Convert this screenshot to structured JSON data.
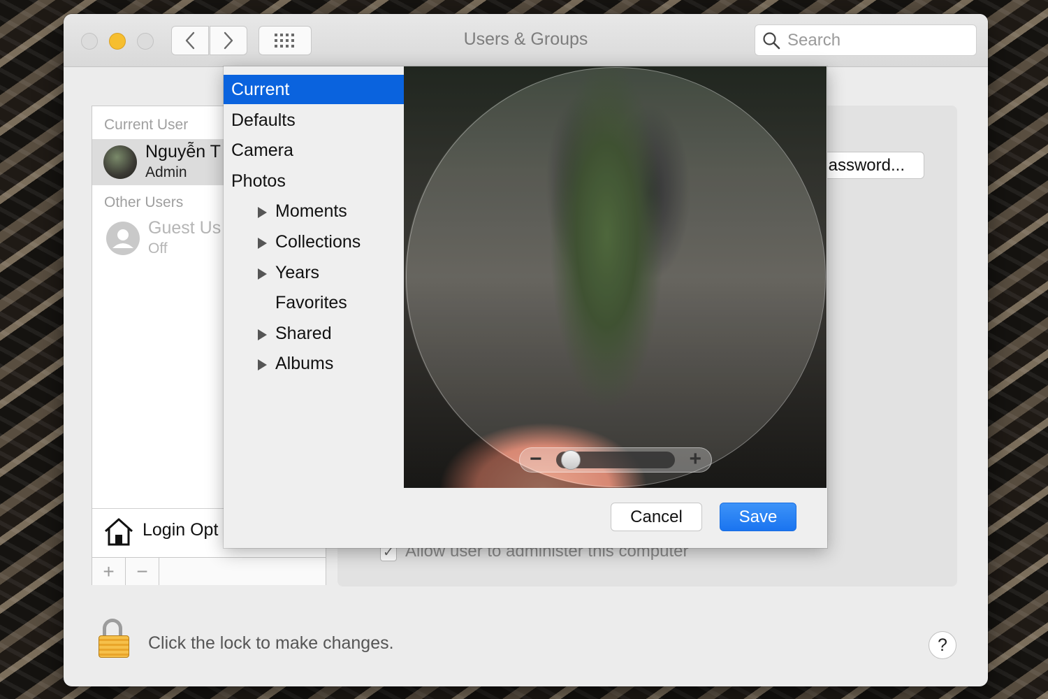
{
  "window": {
    "title": "Users & Groups",
    "search_placeholder": "Search"
  },
  "users": {
    "current_header": "Current User",
    "current_name": "Nguyễn T",
    "current_role": "Admin",
    "other_header": "Other Users",
    "guest_name": "Guest Us",
    "guest_status": "Off",
    "login_options": "Login Opt",
    "add_symbol": "+",
    "remove_symbol": "−"
  },
  "details": {
    "password_button": "assword...",
    "admin_checkbox_label": "Allow user to administer this computer",
    "admin_checked": true
  },
  "picker": {
    "sources": [
      {
        "label": "Current",
        "selected": true,
        "indent": 0,
        "expandable": false
      },
      {
        "label": "Defaults",
        "selected": false,
        "indent": 0,
        "expandable": false
      },
      {
        "label": "Camera",
        "selected": false,
        "indent": 0,
        "expandable": false
      },
      {
        "label": "Photos",
        "selected": false,
        "indent": 0,
        "expandable": false
      },
      {
        "label": "Moments",
        "selected": false,
        "indent": 1,
        "expandable": true
      },
      {
        "label": "Collections",
        "selected": false,
        "indent": 1,
        "expandable": true
      },
      {
        "label": "Years",
        "selected": false,
        "indent": 1,
        "expandable": true
      },
      {
        "label": "Favorites",
        "selected": false,
        "indent": 1,
        "expandable": false
      },
      {
        "label": "Shared",
        "selected": false,
        "indent": 1,
        "expandable": true
      },
      {
        "label": "Albums",
        "selected": false,
        "indent": 1,
        "expandable": true
      }
    ],
    "zoom_minus": "−",
    "zoom_plus": "+",
    "zoom_level": 0.05,
    "cancel_label": "Cancel",
    "save_label": "Save"
  },
  "footer": {
    "lock_text": "Click the lock to make changes.",
    "help_label": "?"
  },
  "colors": {
    "selection": "#0a63de",
    "save_button": "#1a74f0",
    "minimize": "#f6be2f",
    "lock": "#f6c04a"
  }
}
